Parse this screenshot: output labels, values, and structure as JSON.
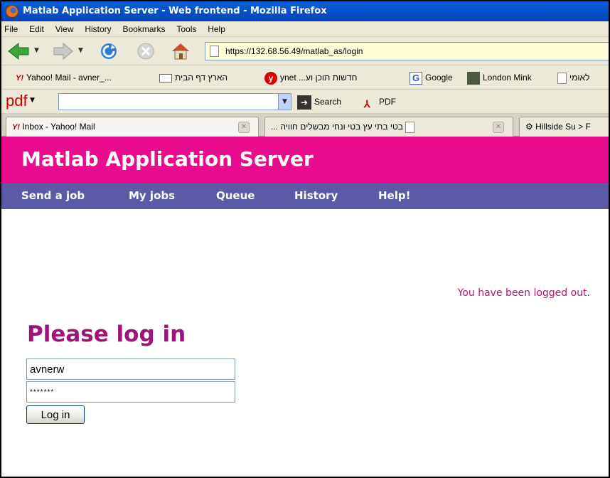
{
  "window": {
    "title": "Matlab Application Server - Web frontend - Mozilla Firefox"
  },
  "menu": [
    "File",
    "Edit",
    "View",
    "History",
    "Bookmarks",
    "Tools",
    "Help"
  ],
  "nav": {
    "url": "https://132.68.56.49/matlab_as/login"
  },
  "bookmarks": {
    "yahoo": "Yahoo! Mail - avner_...",
    "haaretz": "הארץ דף הבית",
    "ynet": "ynet ...חדשות תוכן וע",
    "google": "Google",
    "mink": "London Mink",
    "leumi": "לאומי"
  },
  "pdfbar": {
    "search_value": "",
    "search_label": "Search",
    "pdf_label": "PDF"
  },
  "tabs": [
    {
      "label": "Inbox - Yahoo! Mail"
    },
    {
      "label": "... בטי בתי עץ בטי ונחי מבשלים חוויה"
    },
    {
      "label": "Hillside Su > F"
    }
  ],
  "page": {
    "site_title": "Matlab Application Server",
    "nav_links": [
      "Send a job",
      "My jobs",
      "Queue",
      "History",
      "Help!"
    ],
    "logout_message": "You have been logged out.",
    "login_heading": "Please log in",
    "username_value": "avnerw",
    "password_value": "*******",
    "login_button": "Log in"
  },
  "colors": {
    "header_bg": "#ea0a8e",
    "nav_bg": "#5a5aa6",
    "heading": "#a0127a"
  }
}
